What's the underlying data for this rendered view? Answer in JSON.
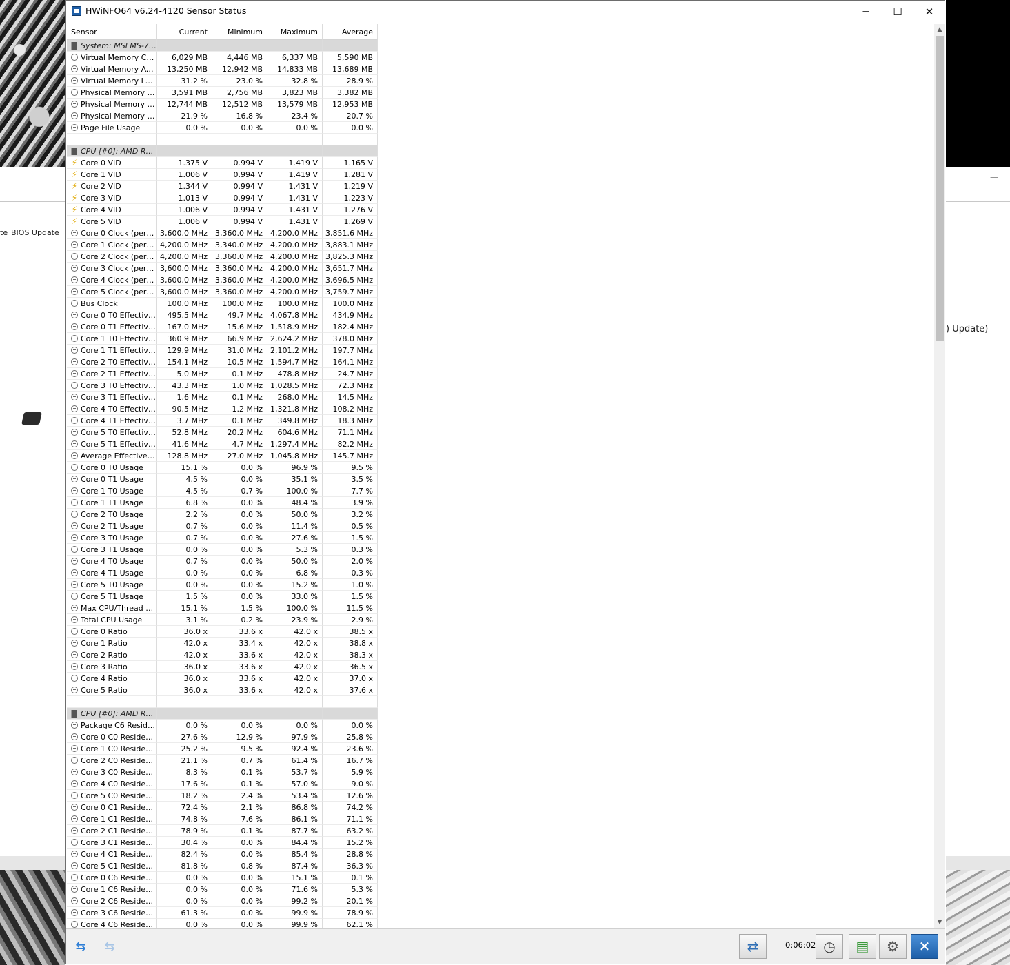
{
  "window": {
    "title": "HWiNFO64 v6.24-4120 Sensor Status",
    "minimize": "─",
    "maximize": "☐",
    "close": "✕"
  },
  "background": {
    "bios_label": "BIOS Update",
    "left_fragment": "te",
    "right_fragment": ") Update)",
    "dash": "—"
  },
  "columns": [
    "Sensor",
    "Current",
    "Minimum",
    "Maximum",
    "Average"
  ],
  "rows": [
    {
      "type": "group",
      "name": "System: MSI MS-7A38"
    },
    {
      "type": "sensor",
      "name": "Virtual Memory Com...",
      "vals": [
        "6,029 MB",
        "4,446 MB",
        "6,337 MB",
        "5,590 MB"
      ]
    },
    {
      "type": "sensor",
      "name": "Virtual Memory Avai...",
      "vals": [
        "13,250 MB",
        "12,942 MB",
        "14,833 MB",
        "13,689 MB"
      ]
    },
    {
      "type": "sensor",
      "name": "Virtual Memory Load",
      "vals": [
        "31.2 %",
        "23.0 %",
        "32.8 %",
        "28.9 %"
      ]
    },
    {
      "type": "sensor",
      "name": "Physical Memory Used",
      "vals": [
        "3,591 MB",
        "2,756 MB",
        "3,823 MB",
        "3,382 MB"
      ]
    },
    {
      "type": "sensor",
      "name": "Physical Memory Av...",
      "vals": [
        "12,744 MB",
        "12,512 MB",
        "13,579 MB",
        "12,953 MB"
      ]
    },
    {
      "type": "sensor",
      "name": "Physical Memory Load",
      "vals": [
        "21.9 %",
        "16.8 %",
        "23.4 %",
        "20.7 %"
      ]
    },
    {
      "type": "sensor",
      "name": "Page File Usage",
      "vals": [
        "0.0 %",
        "0.0 %",
        "0.0 %",
        "0.0 %"
      ]
    },
    {
      "type": "blank"
    },
    {
      "type": "group",
      "name": "CPU [#0]: AMD Ryz..."
    },
    {
      "type": "volt",
      "name": "Core 0 VID",
      "vals": [
        "1.375 V",
        "0.994 V",
        "1.419 V",
        "1.165 V"
      ]
    },
    {
      "type": "volt",
      "name": "Core 1 VID",
      "vals": [
        "1.006 V",
        "0.994 V",
        "1.419 V",
        "1.281 V"
      ]
    },
    {
      "type": "volt",
      "name": "Core 2 VID",
      "vals": [
        "1.344 V",
        "0.994 V",
        "1.431 V",
        "1.219 V"
      ]
    },
    {
      "type": "volt",
      "name": "Core 3 VID",
      "vals": [
        "1.013 V",
        "0.994 V",
        "1.431 V",
        "1.223 V"
      ]
    },
    {
      "type": "volt",
      "name": "Core 4 VID",
      "vals": [
        "1.006 V",
        "0.994 V",
        "1.431 V",
        "1.276 V"
      ]
    },
    {
      "type": "volt",
      "name": "Core 5 VID",
      "vals": [
        "1.006 V",
        "0.994 V",
        "1.431 V",
        "1.269 V"
      ]
    },
    {
      "type": "sensor",
      "name": "Core 0 Clock (perf ...",
      "vals": [
        "3,600.0 MHz",
        "3,360.0 MHz",
        "4,200.0 MHz",
        "3,851.6 MHz"
      ]
    },
    {
      "type": "sensor",
      "name": "Core 1 Clock (perf ...",
      "vals": [
        "4,200.0 MHz",
        "3,340.0 MHz",
        "4,200.0 MHz",
        "3,883.1 MHz"
      ]
    },
    {
      "type": "sensor",
      "name": "Core 2 Clock (perf ...",
      "vals": [
        "4,200.0 MHz",
        "3,360.0 MHz",
        "4,200.0 MHz",
        "3,825.3 MHz"
      ]
    },
    {
      "type": "sensor",
      "name": "Core 3 Clock (perf ...",
      "vals": [
        "3,600.0 MHz",
        "3,360.0 MHz",
        "4,200.0 MHz",
        "3,651.7 MHz"
      ]
    },
    {
      "type": "sensor",
      "name": "Core 4 Clock (perf ...",
      "vals": [
        "3,600.0 MHz",
        "3,360.0 MHz",
        "4,200.0 MHz",
        "3,696.5 MHz"
      ]
    },
    {
      "type": "sensor",
      "name": "Core 5 Clock (perf ...",
      "vals": [
        "3,600.0 MHz",
        "3,360.0 MHz",
        "4,200.0 MHz",
        "3,759.7 MHz"
      ]
    },
    {
      "type": "sensor",
      "name": "Bus Clock",
      "vals": [
        "100.0 MHz",
        "100.0 MHz",
        "100.0 MHz",
        "100.0 MHz"
      ]
    },
    {
      "type": "sensor",
      "name": "Core 0 T0 Effective...",
      "vals": [
        "495.5 MHz",
        "49.7 MHz",
        "4,067.8 MHz",
        "434.9 MHz"
      ]
    },
    {
      "type": "sensor",
      "name": "Core 0 T1 Effective...",
      "vals": [
        "167.0 MHz",
        "15.6 MHz",
        "1,518.9 MHz",
        "182.4 MHz"
      ]
    },
    {
      "type": "sensor",
      "name": "Core 1 T0 Effective...",
      "vals": [
        "360.9 MHz",
        "66.9 MHz",
        "2,624.2 MHz",
        "378.0 MHz"
      ]
    },
    {
      "type": "sensor",
      "name": "Core 1 T1 Effective...",
      "vals": [
        "129.9 MHz",
        "31.0 MHz",
        "2,101.2 MHz",
        "197.7 MHz"
      ]
    },
    {
      "type": "sensor",
      "name": "Core 2 T0 Effective...",
      "vals": [
        "154.1 MHz",
        "10.5 MHz",
        "1,594.7 MHz",
        "164.1 MHz"
      ]
    },
    {
      "type": "sensor",
      "name": "Core 2 T1 Effective...",
      "vals": [
        "5.0 MHz",
        "0.1 MHz",
        "478.8 MHz",
        "24.7 MHz"
      ]
    },
    {
      "type": "sensor",
      "name": "Core 3 T0 Effective...",
      "vals": [
        "43.3 MHz",
        "1.0 MHz",
        "1,028.5 MHz",
        "72.3 MHz"
      ]
    },
    {
      "type": "sensor",
      "name": "Core 3 T1 Effective...",
      "vals": [
        "1.6 MHz",
        "0.1 MHz",
        "268.0 MHz",
        "14.5 MHz"
      ]
    },
    {
      "type": "sensor",
      "name": "Core 4 T0 Effective...",
      "vals": [
        "90.5 MHz",
        "1.2 MHz",
        "1,321.8 MHz",
        "108.2 MHz"
      ]
    },
    {
      "type": "sensor",
      "name": "Core 4 T1 Effective...",
      "vals": [
        "3.7 MHz",
        "0.1 MHz",
        "349.8 MHz",
        "18.3 MHz"
      ]
    },
    {
      "type": "sensor",
      "name": "Core 5 T0 Effective...",
      "vals": [
        "52.8 MHz",
        "20.2 MHz",
        "604.6 MHz",
        "71.1 MHz"
      ]
    },
    {
      "type": "sensor",
      "name": "Core 5 T1 Effective...",
      "vals": [
        "41.6 MHz",
        "4.7 MHz",
        "1,297.4 MHz",
        "82.2 MHz"
      ]
    },
    {
      "type": "sensor",
      "name": "Average Effective ...",
      "vals": [
        "128.8 MHz",
        "27.0 MHz",
        "1,045.8 MHz",
        "145.7 MHz"
      ]
    },
    {
      "type": "sensor",
      "name": "Core 0 T0 Usage",
      "vals": [
        "15.1 %",
        "0.0 %",
        "96.9 %",
        "9.5 %"
      ]
    },
    {
      "type": "sensor",
      "name": "Core 0 T1 Usage",
      "vals": [
        "4.5 %",
        "0.0 %",
        "35.1 %",
        "3.5 %"
      ]
    },
    {
      "type": "sensor",
      "name": "Core 1 T0 Usage",
      "vals": [
        "4.5 %",
        "0.7 %",
        "100.0 %",
        "7.7 %"
      ]
    },
    {
      "type": "sensor",
      "name": "Core 1 T1 Usage",
      "vals": [
        "6.8 %",
        "0.0 %",
        "48.4 %",
        "3.9 %"
      ]
    },
    {
      "type": "sensor",
      "name": "Core 2 T0 Usage",
      "vals": [
        "2.2 %",
        "0.0 %",
        "50.0 %",
        "3.2 %"
      ]
    },
    {
      "type": "sensor",
      "name": "Core 2 T1 Usage",
      "vals": [
        "0.7 %",
        "0.0 %",
        "11.4 %",
        "0.5 %"
      ]
    },
    {
      "type": "sensor",
      "name": "Core 3 T0 Usage",
      "vals": [
        "0.7 %",
        "0.0 %",
        "27.6 %",
        "1.5 %"
      ]
    },
    {
      "type": "sensor",
      "name": "Core 3 T1 Usage",
      "vals": [
        "0.0 %",
        "0.0 %",
        "5.3 %",
        "0.3 %"
      ]
    },
    {
      "type": "sensor",
      "name": "Core 4 T0 Usage",
      "vals": [
        "0.7 %",
        "0.0 %",
        "50.0 %",
        "2.0 %"
      ]
    },
    {
      "type": "sensor",
      "name": "Core 4 T1 Usage",
      "vals": [
        "0.0 %",
        "0.0 %",
        "6.8 %",
        "0.3 %"
      ]
    },
    {
      "type": "sensor",
      "name": "Core 5 T0 Usage",
      "vals": [
        "0.0 %",
        "0.0 %",
        "15.2 %",
        "1.0 %"
      ]
    },
    {
      "type": "sensor",
      "name": "Core 5 T1 Usage",
      "vals": [
        "1.5 %",
        "0.0 %",
        "33.0 %",
        "1.5 %"
      ]
    },
    {
      "type": "sensor",
      "name": "Max CPU/Thread U...",
      "vals": [
        "15.1 %",
        "1.5 %",
        "100.0 %",
        "11.5 %"
      ]
    },
    {
      "type": "sensor",
      "name": "Total CPU Usage",
      "vals": [
        "3.1 %",
        "0.2 %",
        "23.9 %",
        "2.9 %"
      ]
    },
    {
      "type": "sensor",
      "name": "Core 0 Ratio",
      "vals": [
        "36.0 x",
        "33.6 x",
        "42.0 x",
        "38.5 x"
      ]
    },
    {
      "type": "sensor",
      "name": "Core 1 Ratio",
      "vals": [
        "42.0 x",
        "33.4 x",
        "42.0 x",
        "38.8 x"
      ]
    },
    {
      "type": "sensor",
      "name": "Core 2 Ratio",
      "vals": [
        "42.0 x",
        "33.6 x",
        "42.0 x",
        "38.3 x"
      ]
    },
    {
      "type": "sensor",
      "name": "Core 3 Ratio",
      "vals": [
        "36.0 x",
        "33.6 x",
        "42.0 x",
        "36.5 x"
      ]
    },
    {
      "type": "sensor",
      "name": "Core 4 Ratio",
      "vals": [
        "36.0 x",
        "33.6 x",
        "42.0 x",
        "37.0 x"
      ]
    },
    {
      "type": "sensor",
      "name": "Core 5 Ratio",
      "vals": [
        "36.0 x",
        "33.6 x",
        "42.0 x",
        "37.6 x"
      ]
    },
    {
      "type": "blank"
    },
    {
      "type": "group",
      "name": "CPU [#0]: AMD Ryz..."
    },
    {
      "type": "sensor",
      "name": "Package C6 Reside...",
      "vals": [
        "0.0 %",
        "0.0 %",
        "0.0 %",
        "0.0 %"
      ]
    },
    {
      "type": "sensor",
      "name": "Core 0 C0 Residency",
      "vals": [
        "27.6 %",
        "12.9 %",
        "97.9 %",
        "25.8 %"
      ]
    },
    {
      "type": "sensor",
      "name": "Core 1 C0 Residency",
      "vals": [
        "25.2 %",
        "9.5 %",
        "92.4 %",
        "23.6 %"
      ]
    },
    {
      "type": "sensor",
      "name": "Core 2 C0 Residency",
      "vals": [
        "21.1 %",
        "0.7 %",
        "61.4 %",
        "16.7 %"
      ]
    },
    {
      "type": "sensor",
      "name": "Core 3 C0 Residency",
      "vals": [
        "8.3 %",
        "0.1 %",
        "53.7 %",
        "5.9 %"
      ]
    },
    {
      "type": "sensor",
      "name": "Core 4 C0 Residency",
      "vals": [
        "17.6 %",
        "0.1 %",
        "57.0 %",
        "9.0 %"
      ]
    },
    {
      "type": "sensor",
      "name": "Core 5 C0 Residency",
      "vals": [
        "18.2 %",
        "2.4 %",
        "53.4 %",
        "12.6 %"
      ]
    },
    {
      "type": "sensor",
      "name": "Core 0 C1 Residency",
      "vals": [
        "72.4 %",
        "2.1 %",
        "86.8 %",
        "74.2 %"
      ]
    },
    {
      "type": "sensor",
      "name": "Core 1 C1 Residency",
      "vals": [
        "74.8 %",
        "7.6 %",
        "86.1 %",
        "71.1 %"
      ]
    },
    {
      "type": "sensor",
      "name": "Core 2 C1 Residency",
      "vals": [
        "78.9 %",
        "0.1 %",
        "87.7 %",
        "63.2 %"
      ]
    },
    {
      "type": "sensor",
      "name": "Core 3 C1 Residency",
      "vals": [
        "30.4 %",
        "0.0 %",
        "84.4 %",
        "15.2 %"
      ]
    },
    {
      "type": "sensor",
      "name": "Core 4 C1 Residency",
      "vals": [
        "82.4 %",
        "0.0 %",
        "85.4 %",
        "28.8 %"
      ]
    },
    {
      "type": "sensor",
      "name": "Core 5 C1 Residency",
      "vals": [
        "81.8 %",
        "0.8 %",
        "87.4 %",
        "36.3 %"
      ]
    },
    {
      "type": "sensor",
      "name": "Core 0 C6 Residency",
      "vals": [
        "0.0 %",
        "0.0 %",
        "15.1 %",
        "0.1 %"
      ]
    },
    {
      "type": "sensor",
      "name": "Core 1 C6 Residency",
      "vals": [
        "0.0 %",
        "0.0 %",
        "71.6 %",
        "5.3 %"
      ]
    },
    {
      "type": "sensor",
      "name": "Core 2 C6 Residency",
      "vals": [
        "0.0 %",
        "0.0 %",
        "99.2 %",
        "20.1 %"
      ]
    },
    {
      "type": "sensor",
      "name": "Core 3 C6 Residency",
      "vals": [
        "61.3 %",
        "0.0 %",
        "99.9 %",
        "78.9 %"
      ]
    },
    {
      "type": "sensor",
      "name": "Core 4 C6 Residency",
      "vals": [
        "0.0 %",
        "0.0 %",
        "99.9 %",
        "62.1 %"
      ]
    }
  ],
  "toolbar": {
    "timer": "0:06:02",
    "icons": [
      "nav-arrows-icon",
      "nav-arrows-disabled-icon",
      "network-icon",
      "clock-icon",
      "add-log-icon",
      "settings-icon",
      "close-icon"
    ]
  }
}
